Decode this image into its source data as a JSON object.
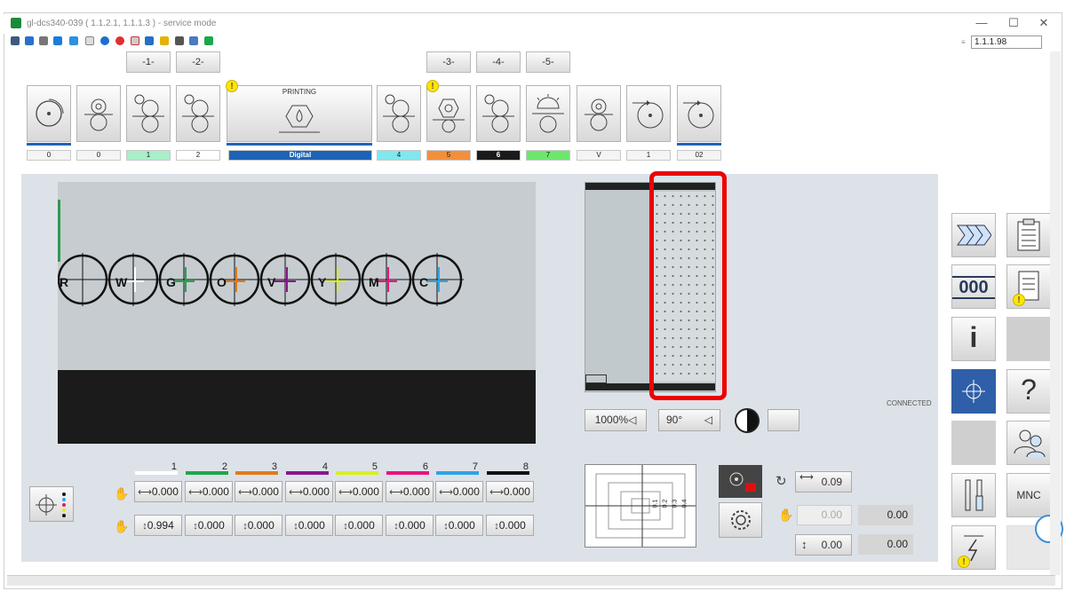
{
  "window": {
    "title": "gl-dcs340-039 ( 1.1.2.1, 1.1.1.3 ) - service mode",
    "version_field": "1.1.1.98",
    "controls": {
      "minimize": "—",
      "maximize": "☐",
      "close": "✕"
    }
  },
  "groups": [
    "-1-",
    "-2-",
    "-3-",
    "-4-",
    "-5-"
  ],
  "units": [
    {
      "label": "0",
      "color": "#f4f4f4"
    },
    {
      "label": "0",
      "color": "#f4f4f4"
    },
    {
      "label": "1",
      "color": "#a8f0c8"
    },
    {
      "label": "2",
      "color": "#ffffff"
    },
    {
      "label": "Digital",
      "color": "#1e63b5",
      "title": "PRINTING"
    },
    {
      "label": "4",
      "color": "#7fe8ee"
    },
    {
      "label": "5",
      "color": "#f28f3b"
    },
    {
      "label": "6",
      "color": "#1a1a1a"
    },
    {
      "label": "7",
      "color": "#6de66d"
    },
    {
      "label": "V",
      "color": "#f4f4f4"
    },
    {
      "label": "1",
      "color": "#f4f4f4"
    },
    {
      "label": "02",
      "color": "#f4f4f4"
    }
  ],
  "camera": {
    "registers": [
      "R",
      "W",
      "G",
      "O",
      "V",
      "Y",
      "M",
      "C"
    ]
  },
  "view": {
    "zoom": "1000%◁",
    "rotation": "90°",
    "status": "CONNECTED"
  },
  "colors": {
    "numbers": [
      "1",
      "2",
      "3",
      "4",
      "5",
      "6",
      "7",
      "8"
    ],
    "bar_colors": [
      "#ffffff",
      "#1fa64a",
      "#e37a1a",
      "#8b168c",
      "#d8ef1e",
      "#e8147e",
      "#2ea3e8",
      "#111111"
    ],
    "horizontal": [
      "0.000",
      "0.000",
      "0.000",
      "0.000",
      "0.000",
      "0.000",
      "0.000",
      "0.000"
    ],
    "vertical": [
      "0.994",
      "0.000",
      "0.000",
      "0.000",
      "0.000",
      "0.000",
      "0.000",
      "0.000"
    ]
  },
  "target": {
    "scale": [
      "0.1",
      "0.2",
      "0.3",
      "0.4"
    ]
  },
  "offsets": {
    "rotation": "0.09",
    "horizontal_set": "0.00",
    "horizontal_actual": "0.00",
    "vertical_set": "0.00",
    "vertical_actual": "0.00"
  },
  "sidebar": {
    "mnc_label": "MNC",
    "counter_label": "000"
  }
}
